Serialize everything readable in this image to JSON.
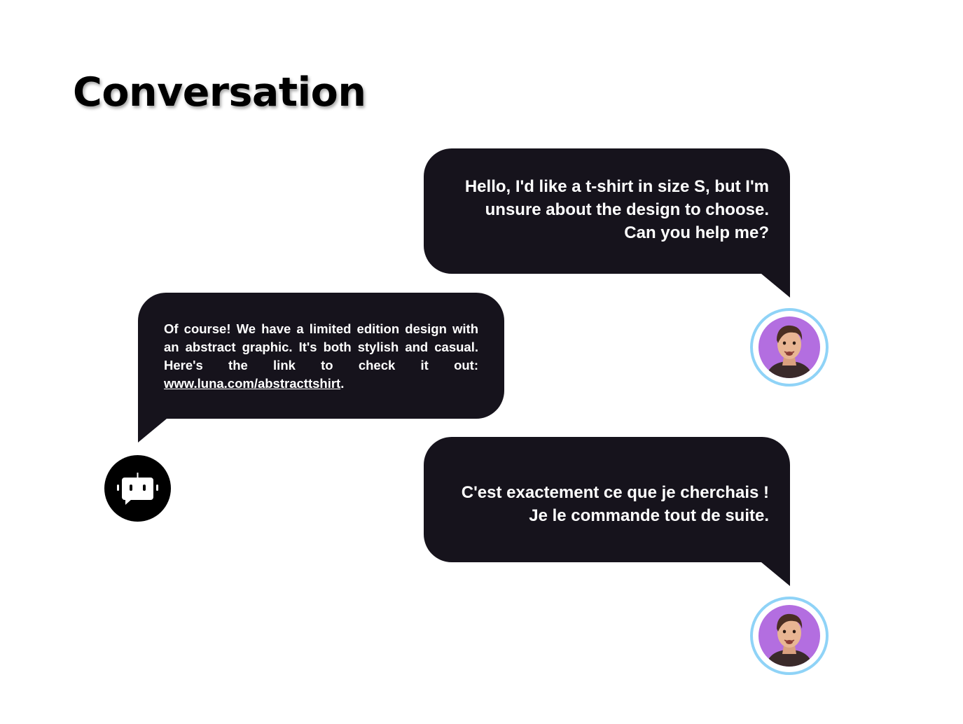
{
  "title": "Conversation",
  "colors": {
    "bubble": "#16131c",
    "bubble_text": "#ffffff",
    "avatar_ring": "#8fd3f7",
    "avatar_bg": "#b36ee0",
    "bot_avatar_bg": "#000000"
  },
  "messages": [
    {
      "sender": "user",
      "avatar_icon": "user-photo-avatar",
      "lines": [
        "Hello, I'd like a t-shirt in size S, but I'm",
        "unsure about the design to choose.",
        "Can you help me?"
      ]
    },
    {
      "sender": "bot",
      "avatar_icon": "chatbot-icon",
      "text": "Of course! We have a limited edition design with an abstract graphic. It's both stylish and casual. Here's the link to check it out: ",
      "link": "www.luna.com/abstracttshirt",
      "after_link": "."
    },
    {
      "sender": "user",
      "avatar_icon": "user-photo-avatar",
      "lines": [
        "C'est exactement ce que je cherchais !",
        "Je le commande tout de suite."
      ]
    }
  ]
}
